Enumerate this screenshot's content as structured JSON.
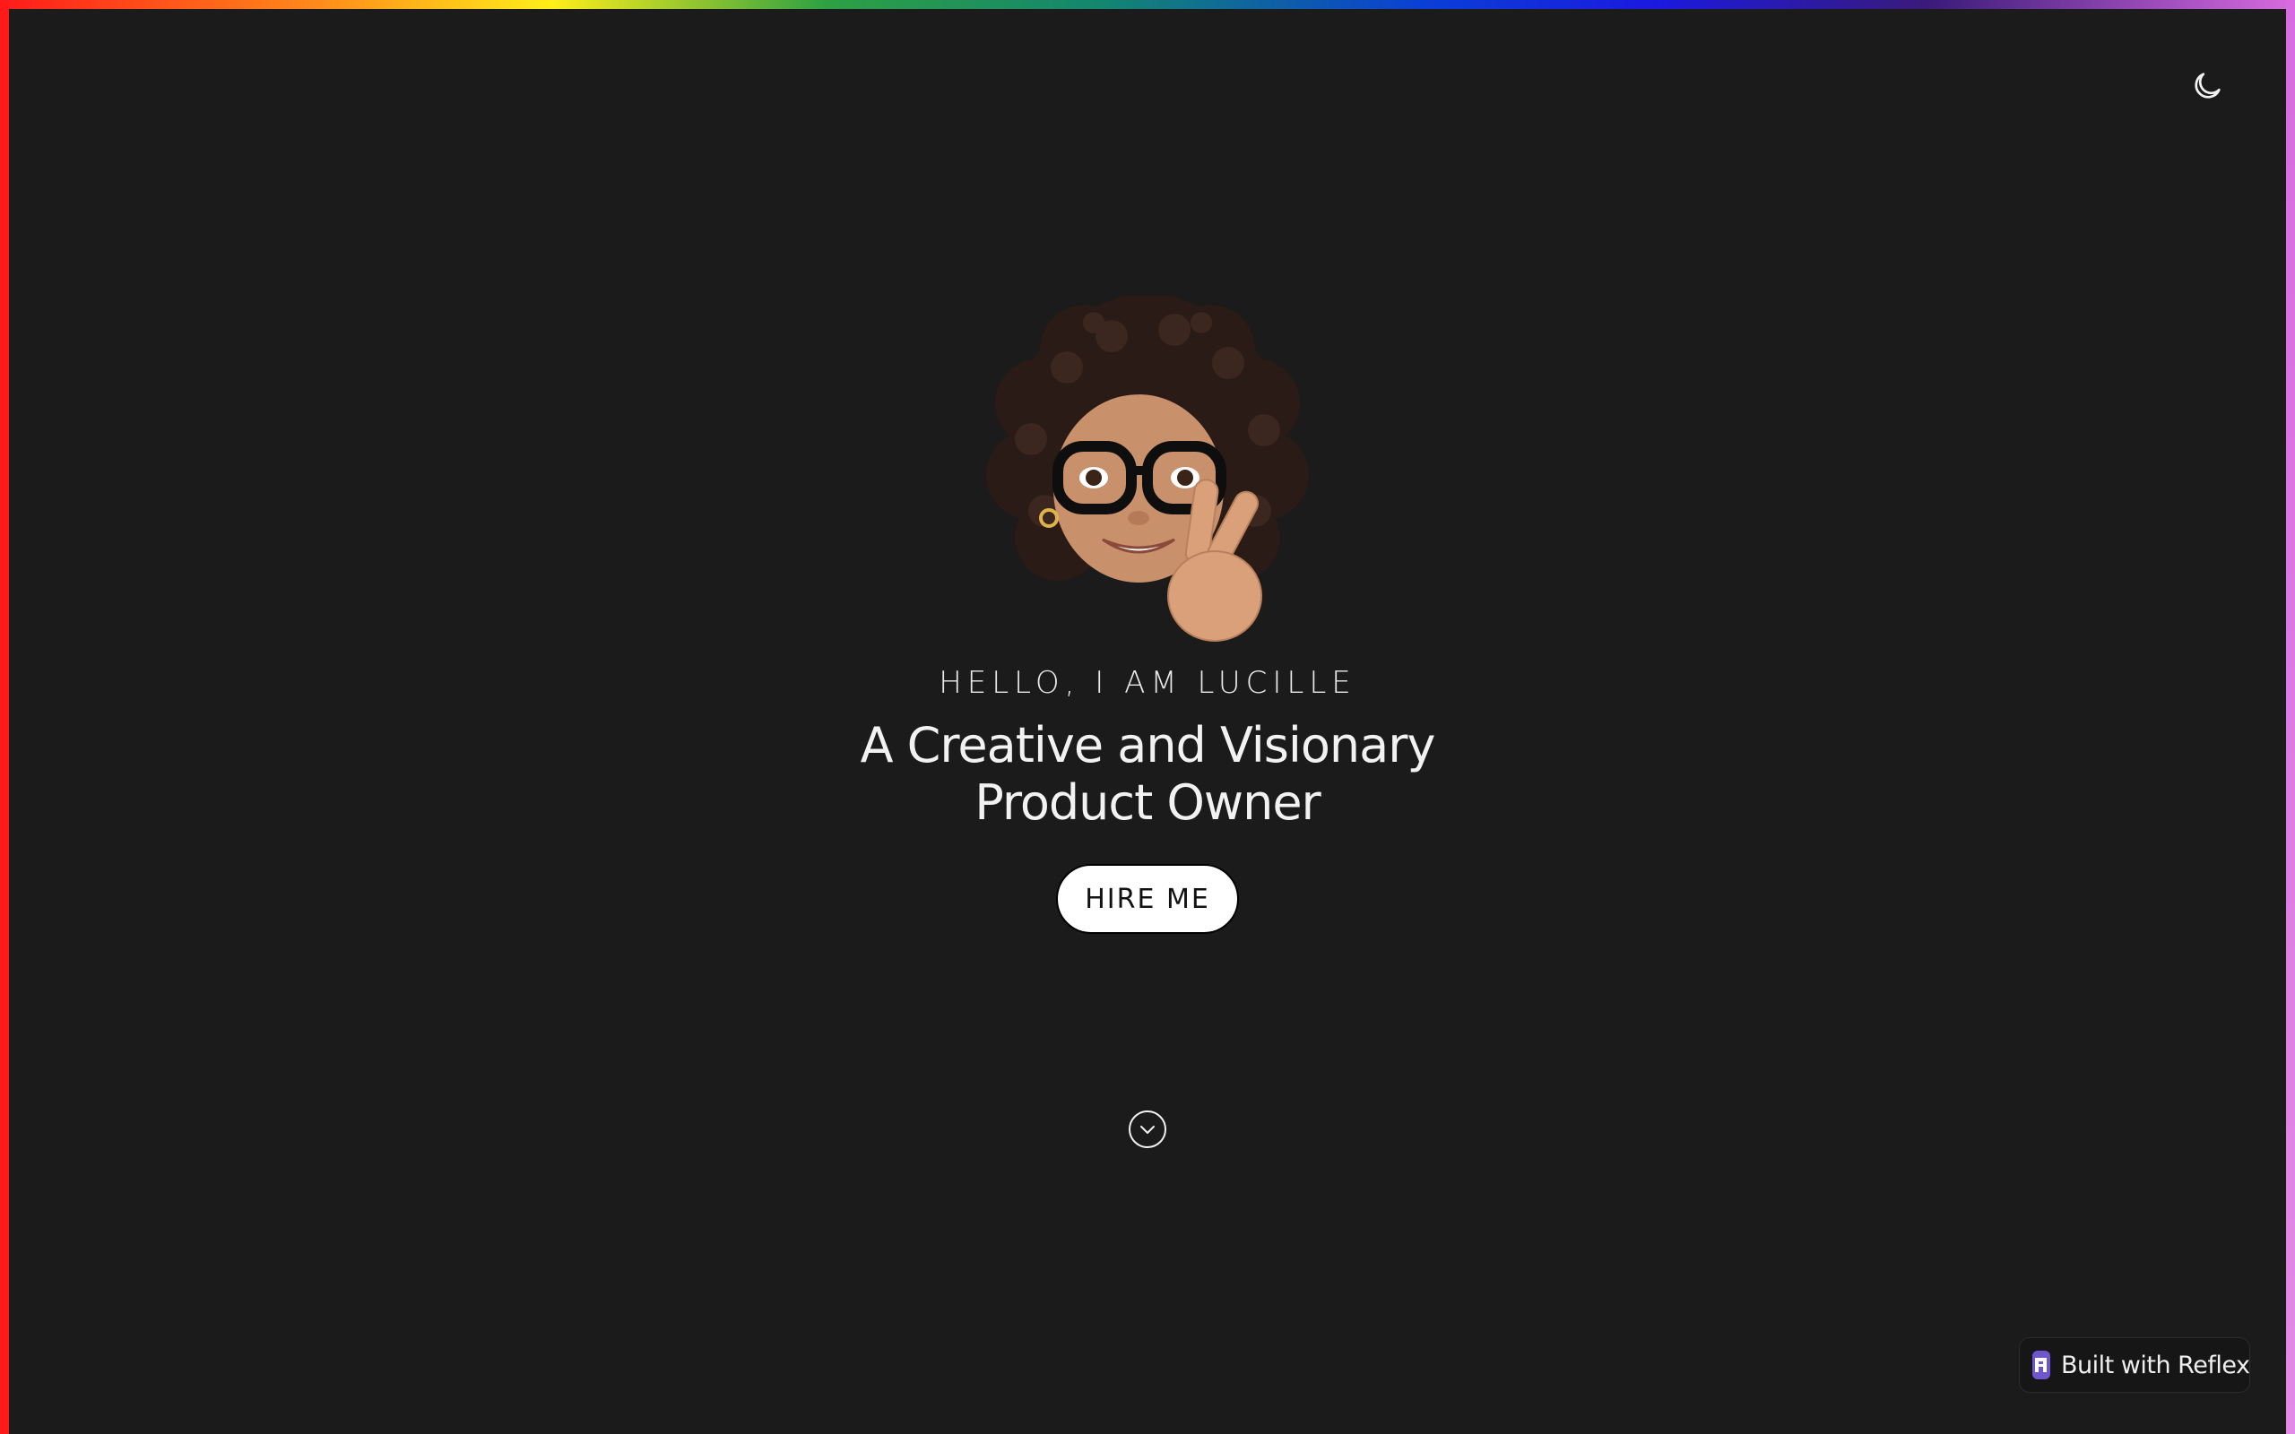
{
  "hero": {
    "greeting": "HELLO, I AM LUCILLE",
    "headline": "A Creative and Visionary Product Owner",
    "cta_label": "HIRE ME",
    "avatar_icon": "memoji-peace-sign-avatar"
  },
  "header": {
    "theme_toggle_icon": "moon-icon"
  },
  "scroll": {
    "icon": "chevron-down-circle-icon"
  },
  "badge": {
    "label": "Built with  Reflex",
    "logo_icon": "reflex-logo-icon"
  },
  "colors": {
    "background": "#1b1b1b",
    "text": "#f2f2f2",
    "accent": "#6e56cf",
    "button_bg": "#ffffff"
  }
}
